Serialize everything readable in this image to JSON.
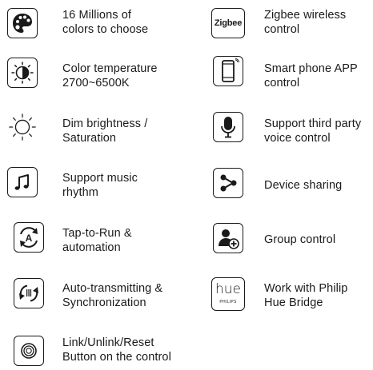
{
  "features": [
    {
      "id": "colors",
      "icon": "palette-icon",
      "line1": "16 Millions of",
      "line2": "colors to choose"
    },
    {
      "id": "zigbee",
      "icon": "zigbee-logo-icon",
      "icon_text": "Zigbee",
      "line1": "Zigbee wireless",
      "line2": "control"
    },
    {
      "id": "color-temp",
      "icon": "color-temperature-icon",
      "line1": "Color temperature",
      "line2": "2700~6500K"
    },
    {
      "id": "app",
      "icon": "smartphone-icon",
      "line1": "Smart phone APP",
      "line2": "control"
    },
    {
      "id": "dim",
      "icon": "sun-brightness-icon",
      "line1": "Dim brightness /",
      "line2": "Saturation"
    },
    {
      "id": "voice",
      "icon": "microphone-icon",
      "line1": "Support third party",
      "line2": "voice control"
    },
    {
      "id": "music",
      "icon": "music-note-icon",
      "line1": "Support music",
      "line2": "rhythm"
    },
    {
      "id": "sharing",
      "icon": "share-icon",
      "line1": "Device sharing",
      "line2": ""
    },
    {
      "id": "tap",
      "icon": "tap-to-run-icon",
      "icon_text": "A",
      "line1": "Tap-to-Run &",
      "line2": "automation"
    },
    {
      "id": "group",
      "icon": "group-add-icon",
      "line1": "Group control",
      "line2": ""
    },
    {
      "id": "sync",
      "icon": "sync-icon",
      "line1": "Auto-transmitting &",
      "line2": "Synchronization"
    },
    {
      "id": "hue",
      "icon": "hue-logo-icon",
      "icon_text": "hue",
      "icon_subtext": "PHILIPS",
      "line1": "Work with Philip",
      "line2": "Hue Bridge"
    },
    {
      "id": "button",
      "icon": "reset-button-icon",
      "line1": "Link/Unlink/Reset",
      "line2": "Button on the control"
    }
  ]
}
